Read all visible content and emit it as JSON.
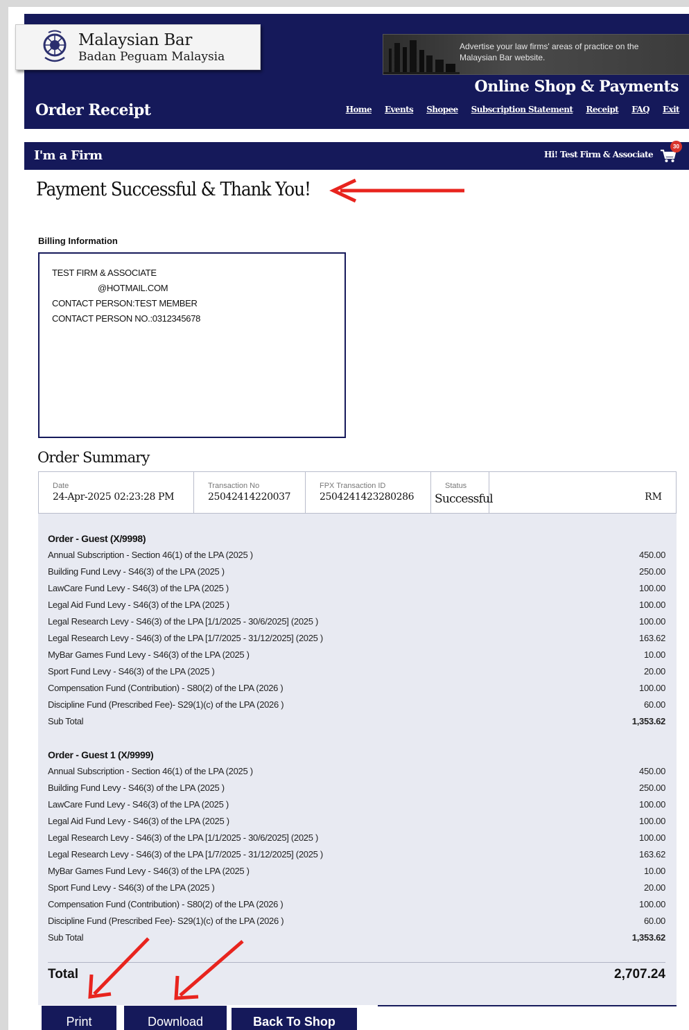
{
  "header": {
    "logo_title": "Malaysian Bar",
    "logo_subtitle": "Badan Peguam Malaysia",
    "ad_text": "Advertise your law firms' areas of practice on the Malaysian Bar website.",
    "shop_title": "Online Shop & Payments",
    "page_title": "Order Receipt",
    "nav": [
      "Home",
      "Events",
      "Shopee",
      "Subscription Statement",
      "Receipt",
      "FAQ",
      "Exit"
    ]
  },
  "firm_bar": {
    "label": "I'm a Firm",
    "greeting": "Hi! Test Firm & Associate",
    "cart_count": "30",
    "cart_icon": "shopping-cart-icon"
  },
  "payment_heading": "Payment Successful & Thank You!",
  "billing": {
    "label": "Billing Information",
    "lines": [
      "TEST FIRM & ASSOCIATE",
      "@HOTMAIL.COM",
      "CONTACT PERSON:TEST MEMBER",
      "CONTACT PERSON NO.:0312345678"
    ]
  },
  "summary": {
    "title": "Order Summary",
    "date_label": "Date",
    "date_value": "24-Apr-2025 02:23:28 PM",
    "txn_label": "Transaction No",
    "txn_value": "25042414220037",
    "fpx_label": "FPX Transaction ID",
    "fpx_value": "2504241423280286",
    "status_label": "Status",
    "status_value": "Successful",
    "currency": "RM"
  },
  "orders": [
    {
      "title": "Order - Guest (X/9998)",
      "items": [
        {
          "desc": "Annual Subscription - Section 46(1) of the LPA (2025 )",
          "amount": "450.00"
        },
        {
          "desc": "Building Fund Levy - S46(3) of the LPA (2025 )",
          "amount": "250.00"
        },
        {
          "desc": "LawCare Fund Levy - S46(3) of the LPA (2025 )",
          "amount": "100.00"
        },
        {
          "desc": "Legal Aid Fund Levy - S46(3) of the LPA (2025 )",
          "amount": "100.00"
        },
        {
          "desc": "Legal Research Levy - S46(3) of the LPA [1/1/2025 - 30/6/2025] (2025 )",
          "amount": "100.00"
        },
        {
          "desc": "Legal Research Levy - S46(3) of the LPA [1/7/2025 - 31/12/2025] (2025 )",
          "amount": "163.62"
        },
        {
          "desc": "MyBar Games Fund Levy - S46(3) of the LPA (2025 )",
          "amount": "10.00"
        },
        {
          "desc": "Sport Fund Levy - S46(3) of the LPA (2025 )",
          "amount": "20.00"
        },
        {
          "desc": "Compensation Fund (Contribution) - S80(2) of the LPA (2026 )",
          "amount": "100.00"
        },
        {
          "desc": "Discipline Fund (Prescribed Fee)- S29(1)(c) of the LPA (2026 )",
          "amount": "60.00"
        }
      ],
      "subtotal_label": "Sub Total",
      "subtotal": "1,353.62"
    },
    {
      "title": "Order - Guest 1 (X/9999)",
      "items": [
        {
          "desc": "Annual Subscription - Section 46(1) of the LPA (2025 )",
          "amount": "450.00"
        },
        {
          "desc": "Building Fund Levy - S46(3) of the LPA (2025 )",
          "amount": "250.00"
        },
        {
          "desc": "LawCare Fund Levy - S46(3) of the LPA (2025 )",
          "amount": "100.00"
        },
        {
          "desc": "Legal Aid Fund Levy - S46(3) of the LPA (2025 )",
          "amount": "100.00"
        },
        {
          "desc": "Legal Research Levy - S46(3) of the LPA [1/1/2025 - 30/6/2025] (2025 )",
          "amount": "100.00"
        },
        {
          "desc": "Legal Research Levy - S46(3) of the LPA [1/7/2025 - 31/12/2025] (2025 )",
          "amount": "163.62"
        },
        {
          "desc": "MyBar Games Fund Levy - S46(3) of the LPA (2025 )",
          "amount": "10.00"
        },
        {
          "desc": "Sport Fund Levy - S46(3) of the LPA (2025 )",
          "amount": "20.00"
        },
        {
          "desc": "Compensation Fund (Contribution) - S80(2) of the LPA (2026 )",
          "amount": "100.00"
        },
        {
          "desc": "Discipline Fund (Prescribed Fee)- S29(1)(c) of the LPA (2026 )",
          "amount": "60.00"
        }
      ],
      "subtotal_label": "Sub Total",
      "subtotal": "1,353.62"
    }
  ],
  "total": {
    "label": "Total",
    "amount": "2,707.24"
  },
  "buttons": {
    "print": "Print",
    "download": "Download",
    "back": "Back To Shop"
  },
  "colors": {
    "navy": "#15195a",
    "annotation_red": "#e8241e",
    "panel": "#e8eaf2"
  }
}
